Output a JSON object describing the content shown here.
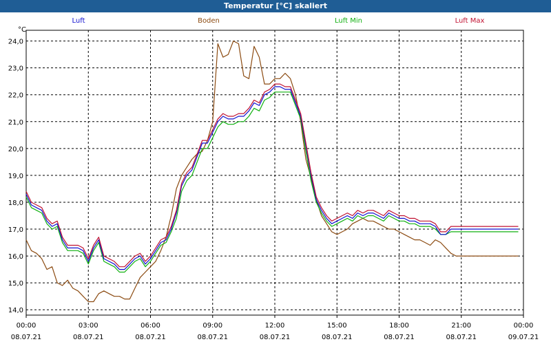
{
  "window": {
    "title": "Temperatur [°C] skaliert"
  },
  "legend": [
    {
      "name": "Luft",
      "color": "#1010d0"
    },
    {
      "name": "Boden",
      "color": "#8b4a10"
    },
    {
      "name": "Luft Min",
      "color": "#10b010"
    },
    {
      "name": "Luft Max",
      "color": "#c01030"
    }
  ],
  "chart_data": {
    "type": "line",
    "title": "Temperatur [°C] skaliert",
    "ylabel": "°C",
    "ylim": [
      13.8,
      24.4
    ],
    "xlim": [
      0,
      24
    ],
    "grid": true,
    "yticks": [
      "24,0",
      "23,0",
      "22,0",
      "21,0",
      "20,0",
      "19,0",
      "18,0",
      "17,0",
      "16,0",
      "15,0",
      "14,0"
    ],
    "yticks_values": [
      24,
      23,
      22,
      21,
      20,
      19,
      18,
      17,
      16,
      15,
      14
    ],
    "xticks_time": [
      "00:00",
      "03:00",
      "06:00",
      "09:00",
      "12:00",
      "15:00",
      "18:00",
      "21:00",
      "00:00"
    ],
    "xticks_date": [
      "08.07.21",
      "08.07.21",
      "08.07.21",
      "08.07.21",
      "08.07.21",
      "08.07.21",
      "08.07.21",
      "08.07.21",
      "09.07.21"
    ],
    "xticks_values": [
      0,
      3,
      6,
      9,
      12,
      15,
      18,
      21,
      24
    ],
    "series": [
      {
        "name": "Luft",
        "color": "#1010d0",
        "x": [
          0,
          0.25,
          0.5,
          0.75,
          1,
          1.25,
          1.5,
          1.75,
          2,
          2.25,
          2.5,
          2.75,
          3,
          3.25,
          3.5,
          3.75,
          4,
          4.25,
          4.5,
          4.75,
          5,
          5.25,
          5.5,
          5.75,
          6,
          6.25,
          6.5,
          6.75,
          7,
          7.25,
          7.5,
          7.75,
          8,
          8.25,
          8.5,
          8.75,
          9,
          9.25,
          9.5,
          9.75,
          10,
          10.25,
          10.5,
          10.75,
          11,
          11.25,
          11.5,
          11.75,
          12,
          12.25,
          12.5,
          12.75,
          13,
          13.25,
          13.5,
          13.75,
          14,
          14.25,
          14.5,
          14.75,
          15,
          15.25,
          15.5,
          15.75,
          16,
          16.25,
          16.5,
          16.75,
          17,
          17.25,
          17.5,
          17.75,
          18,
          18.25,
          18.5,
          18.75,
          19,
          19.25,
          19.5,
          19.75,
          20,
          20.25,
          20.5,
          20.75,
          21,
          21.25,
          21.5,
          21.75,
          22,
          22.25,
          22.5,
          22.75,
          23,
          23.25,
          23.5,
          23.75
        ],
        "y": [
          18.3,
          17.9,
          17.8,
          17.7,
          17.3,
          17.1,
          17.2,
          16.6,
          16.3,
          16.3,
          16.3,
          16.2,
          15.8,
          16.3,
          16.6,
          15.9,
          15.8,
          15.7,
          15.5,
          15.5,
          15.7,
          15.9,
          16.0,
          15.7,
          15.9,
          16.2,
          16.5,
          16.6,
          17.0,
          17.6,
          18.6,
          19.0,
          19.2,
          19.7,
          20.2,
          20.2,
          20.6,
          21.0,
          21.2,
          21.1,
          21.1,
          21.2,
          21.2,
          21.4,
          21.7,
          21.6,
          22.0,
          22.1,
          22.3,
          22.3,
          22.2,
          22.2,
          21.7,
          21.2,
          20.1,
          19.0,
          18.1,
          17.7,
          17.4,
          17.2,
          17.3,
          17.4,
          17.5,
          17.4,
          17.6,
          17.5,
          17.6,
          17.6,
          17.5,
          17.4,
          17.6,
          17.5,
          17.4,
          17.4,
          17.3,
          17.3,
          17.2,
          17.2,
          17.2,
          17.1,
          16.8,
          16.8,
          17.0,
          17.0,
          17.0,
          17.0,
          17.0,
          17.0,
          17.0,
          17.0,
          17.0,
          17.0,
          17.0,
          17.0,
          17.0,
          17.0
        ]
      },
      {
        "name": "Boden",
        "color": "#8b4a10",
        "x": [
          0,
          0.25,
          0.5,
          0.75,
          1,
          1.25,
          1.5,
          1.75,
          2,
          2.25,
          2.5,
          2.75,
          3,
          3.25,
          3.5,
          3.75,
          4,
          4.25,
          4.5,
          4.75,
          5,
          5.25,
          5.5,
          5.75,
          6,
          6.25,
          6.5,
          6.75,
          7,
          7.25,
          7.5,
          7.75,
          8,
          8.25,
          8.5,
          8.75,
          9,
          9.25,
          9.5,
          9.75,
          10,
          10.25,
          10.5,
          10.75,
          11,
          11.25,
          11.5,
          11.75,
          12,
          12.25,
          12.5,
          12.75,
          13,
          13.25,
          13.5,
          13.75,
          14,
          14.25,
          14.5,
          14.75,
          15,
          15.25,
          15.5,
          15.75,
          16,
          16.25,
          16.5,
          16.75,
          17,
          17.25,
          17.5,
          17.75,
          18,
          18.25,
          18.5,
          18.75,
          19,
          19.25,
          19.5,
          19.75,
          20,
          20.25,
          20.5,
          20.75,
          21,
          21.25,
          21.5,
          21.75,
          22,
          22.25,
          22.5,
          22.75,
          23,
          23.25,
          23.5,
          23.75
        ],
        "y": [
          16.6,
          16.2,
          16.1,
          15.9,
          15.5,
          15.6,
          15.0,
          14.9,
          15.1,
          14.8,
          14.7,
          14.5,
          14.3,
          14.3,
          14.6,
          14.7,
          14.6,
          14.5,
          14.5,
          14.4,
          14.4,
          14.8,
          15.2,
          15.4,
          15.6,
          15.8,
          16.2,
          16.7,
          17.5,
          18.5,
          19.0,
          19.3,
          19.6,
          19.8,
          19.9,
          20.3,
          21.0,
          23.9,
          23.4,
          23.5,
          24.0,
          23.9,
          22.7,
          22.6,
          23.8,
          23.4,
          22.4,
          22.4,
          22.6,
          22.6,
          22.8,
          22.6,
          22.0,
          21.0,
          19.6,
          18.9,
          18.1,
          17.5,
          17.2,
          16.9,
          16.8,
          16.9,
          17.0,
          17.2,
          17.3,
          17.4,
          17.3,
          17.3,
          17.2,
          17.1,
          17.0,
          17.0,
          16.9,
          16.8,
          16.7,
          16.6,
          16.6,
          16.5,
          16.4,
          16.6,
          16.5,
          16.3,
          16.1,
          16.0,
          16.0,
          16.0,
          16.0,
          16.0,
          16.0,
          16.0,
          16.0,
          16.0,
          16.0,
          16.0,
          16.0,
          16.0
        ]
      },
      {
        "name": "Luft Min",
        "color": "#10b010",
        "x": [
          0,
          0.25,
          0.5,
          0.75,
          1,
          1.25,
          1.5,
          1.75,
          2,
          2.25,
          2.5,
          2.75,
          3,
          3.25,
          3.5,
          3.75,
          4,
          4.25,
          4.5,
          4.75,
          5,
          5.25,
          5.5,
          5.75,
          6,
          6.25,
          6.5,
          6.75,
          7,
          7.25,
          7.5,
          7.75,
          8,
          8.25,
          8.5,
          8.75,
          9,
          9.25,
          9.5,
          9.75,
          10,
          10.25,
          10.5,
          10.75,
          11,
          11.25,
          11.5,
          11.75,
          12,
          12.25,
          12.5,
          12.75,
          13,
          13.25,
          13.5,
          13.75,
          14,
          14.25,
          14.5,
          14.75,
          15,
          15.25,
          15.5,
          15.75,
          16,
          16.25,
          16.5,
          16.75,
          17,
          17.25,
          17.5,
          17.75,
          18,
          18.25,
          18.5,
          18.75,
          19,
          19.25,
          19.5,
          19.75,
          20,
          20.25,
          20.5,
          20.75,
          21,
          21.25,
          21.5,
          21.75,
          22,
          22.25,
          22.5,
          22.75,
          23,
          23.25,
          23.5,
          23.75
        ],
        "y": [
          18.2,
          17.8,
          17.7,
          17.6,
          17.2,
          17.0,
          17.1,
          16.5,
          16.2,
          16.2,
          16.2,
          16.1,
          15.7,
          16.2,
          16.5,
          15.8,
          15.7,
          15.6,
          15.4,
          15.4,
          15.6,
          15.8,
          15.9,
          15.6,
          15.8,
          16.1,
          16.4,
          16.5,
          16.9,
          17.4,
          18.4,
          18.8,
          19.0,
          19.5,
          20.0,
          20.0,
          20.4,
          20.8,
          21.0,
          20.9,
          20.9,
          21.0,
          21.0,
          21.2,
          21.5,
          21.4,
          21.8,
          21.9,
          22.1,
          22.1,
          22.1,
          22.1,
          21.6,
          21.1,
          19.9,
          18.8,
          18.0,
          17.6,
          17.3,
          17.1,
          17.2,
          17.3,
          17.4,
          17.3,
          17.5,
          17.4,
          17.5,
          17.5,
          17.4,
          17.3,
          17.5,
          17.4,
          17.3,
          17.3,
          17.2,
          17.2,
          17.1,
          17.1,
          17.1,
          17.0,
          16.8,
          16.8,
          16.9,
          16.9,
          16.9,
          16.9,
          16.9,
          16.9,
          16.9,
          16.9,
          16.9,
          16.9,
          16.9,
          16.9,
          16.9,
          16.9
        ]
      },
      {
        "name": "Luft Max",
        "color": "#c01030",
        "x": [
          0,
          0.25,
          0.5,
          0.75,
          1,
          1.25,
          1.5,
          1.75,
          2,
          2.25,
          2.5,
          2.75,
          3,
          3.25,
          3.5,
          3.75,
          4,
          4.25,
          4.5,
          4.75,
          5,
          5.25,
          5.5,
          5.75,
          6,
          6.25,
          6.5,
          6.75,
          7,
          7.25,
          7.5,
          7.75,
          8,
          8.25,
          8.5,
          8.75,
          9,
          9.25,
          9.5,
          9.75,
          10,
          10.25,
          10.5,
          10.75,
          11,
          11.25,
          11.5,
          11.75,
          12,
          12.25,
          12.5,
          12.75,
          13,
          13.25,
          13.5,
          13.75,
          14,
          14.25,
          14.5,
          14.75,
          15,
          15.25,
          15.5,
          15.75,
          16,
          16.25,
          16.5,
          16.75,
          17,
          17.25,
          17.5,
          17.75,
          18,
          18.25,
          18.5,
          18.75,
          19,
          19.25,
          19.5,
          19.75,
          20,
          20.25,
          20.5,
          20.75,
          21,
          21.25,
          21.5,
          21.75,
          22,
          22.25,
          22.5,
          22.75,
          23,
          23.25,
          23.5,
          23.75
        ],
        "y": [
          18.4,
          18.0,
          17.9,
          17.8,
          17.4,
          17.2,
          17.3,
          16.7,
          16.4,
          16.4,
          16.4,
          16.3,
          15.9,
          16.4,
          16.7,
          16.0,
          15.9,
          15.8,
          15.6,
          15.6,
          15.8,
          16.0,
          16.1,
          15.8,
          16.0,
          16.3,
          16.6,
          16.7,
          17.1,
          17.7,
          18.7,
          19.1,
          19.3,
          19.8,
          20.3,
          20.3,
          20.7,
          21.1,
          21.3,
          21.2,
          21.2,
          21.3,
          21.3,
          21.5,
          21.8,
          21.7,
          22.1,
          22.2,
          22.4,
          22.4,
          22.3,
          22.3,
          21.8,
          21.3,
          20.2,
          19.1,
          18.2,
          17.8,
          17.5,
          17.3,
          17.4,
          17.5,
          17.6,
          17.5,
          17.7,
          17.6,
          17.7,
          17.7,
          17.6,
          17.5,
          17.7,
          17.6,
          17.5,
          17.5,
          17.4,
          17.4,
          17.3,
          17.3,
          17.3,
          17.2,
          16.9,
          16.9,
          17.1,
          17.1,
          17.1,
          17.1,
          17.1,
          17.1,
          17.1,
          17.1,
          17.1,
          17.1,
          17.1,
          17.1,
          17.1,
          17.1
        ]
      }
    ]
  }
}
